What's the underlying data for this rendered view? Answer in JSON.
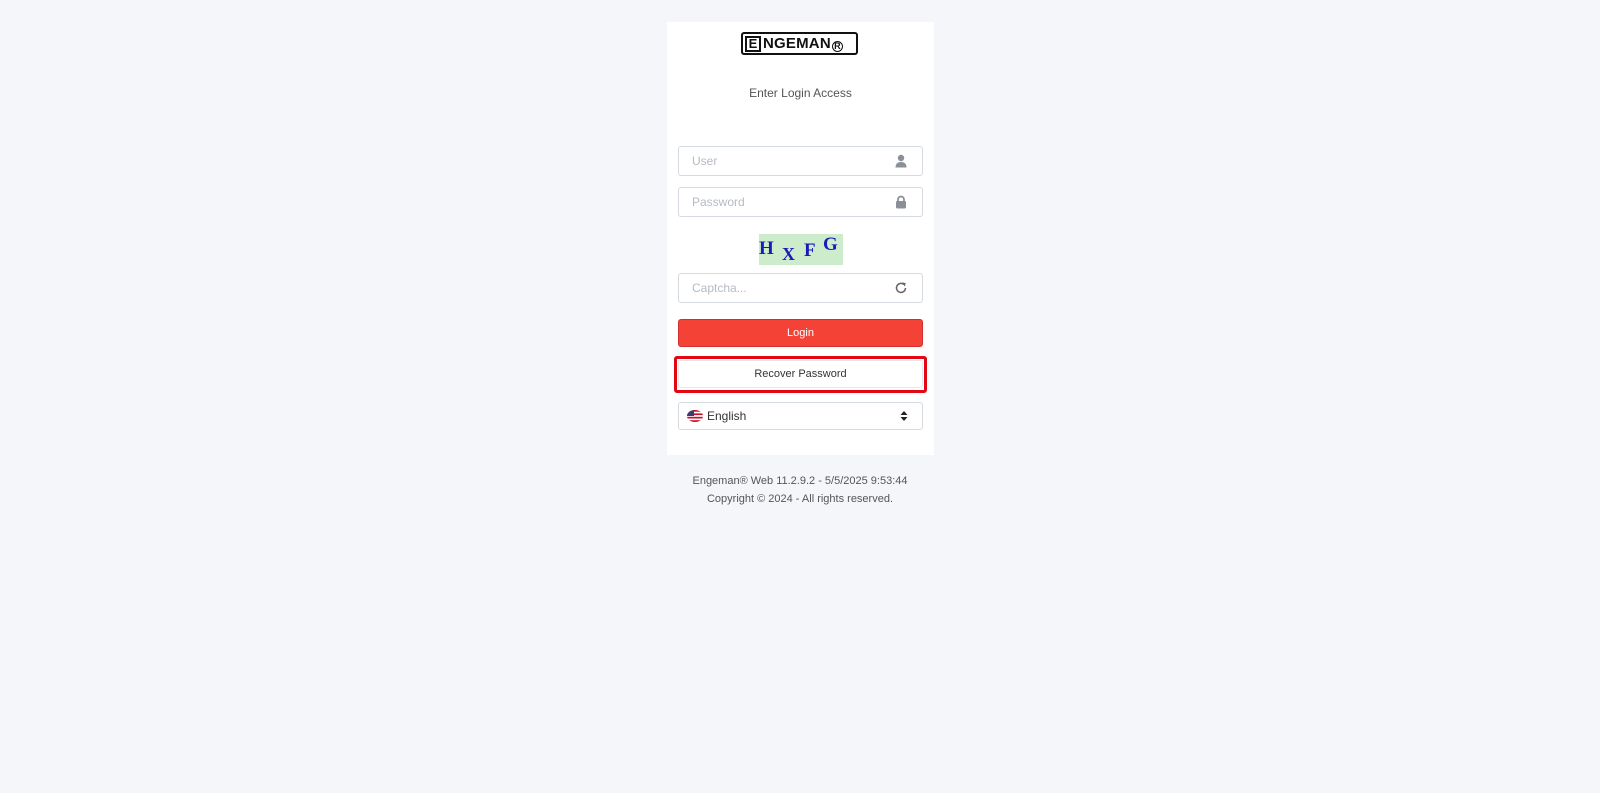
{
  "brand": {
    "logo_text": "ENGEMAN",
    "logo_mark": "E",
    "logo_rest": "NGEMAN",
    "logo_registered": "R"
  },
  "login": {
    "subtitle": "Enter Login Access",
    "user_placeholder": "User",
    "password_placeholder": "Password",
    "captcha_chars": [
      "H",
      "X",
      "F",
      "G"
    ],
    "captcha_placeholder": "Captcha...",
    "login_label": "Login",
    "recover_label": "Recover Password",
    "language": "English"
  },
  "icons": {
    "user": "user-icon",
    "password": "lock-icon",
    "captcha_refresh": "refresh-icon",
    "language_flag": "us-flag-icon",
    "language_caret": "sort-caret-icon"
  },
  "colors": {
    "login_button": "#f44336",
    "highlight": "#e30613",
    "captcha_bg": "#cdeccb",
    "captcha_text": "#1a1ab8"
  },
  "footer": {
    "version": "Engeman® Web 11.2.9.2 - 5/5/2025 9:53:44",
    "copyright": "Copyright © 2024 - All rights reserved."
  }
}
